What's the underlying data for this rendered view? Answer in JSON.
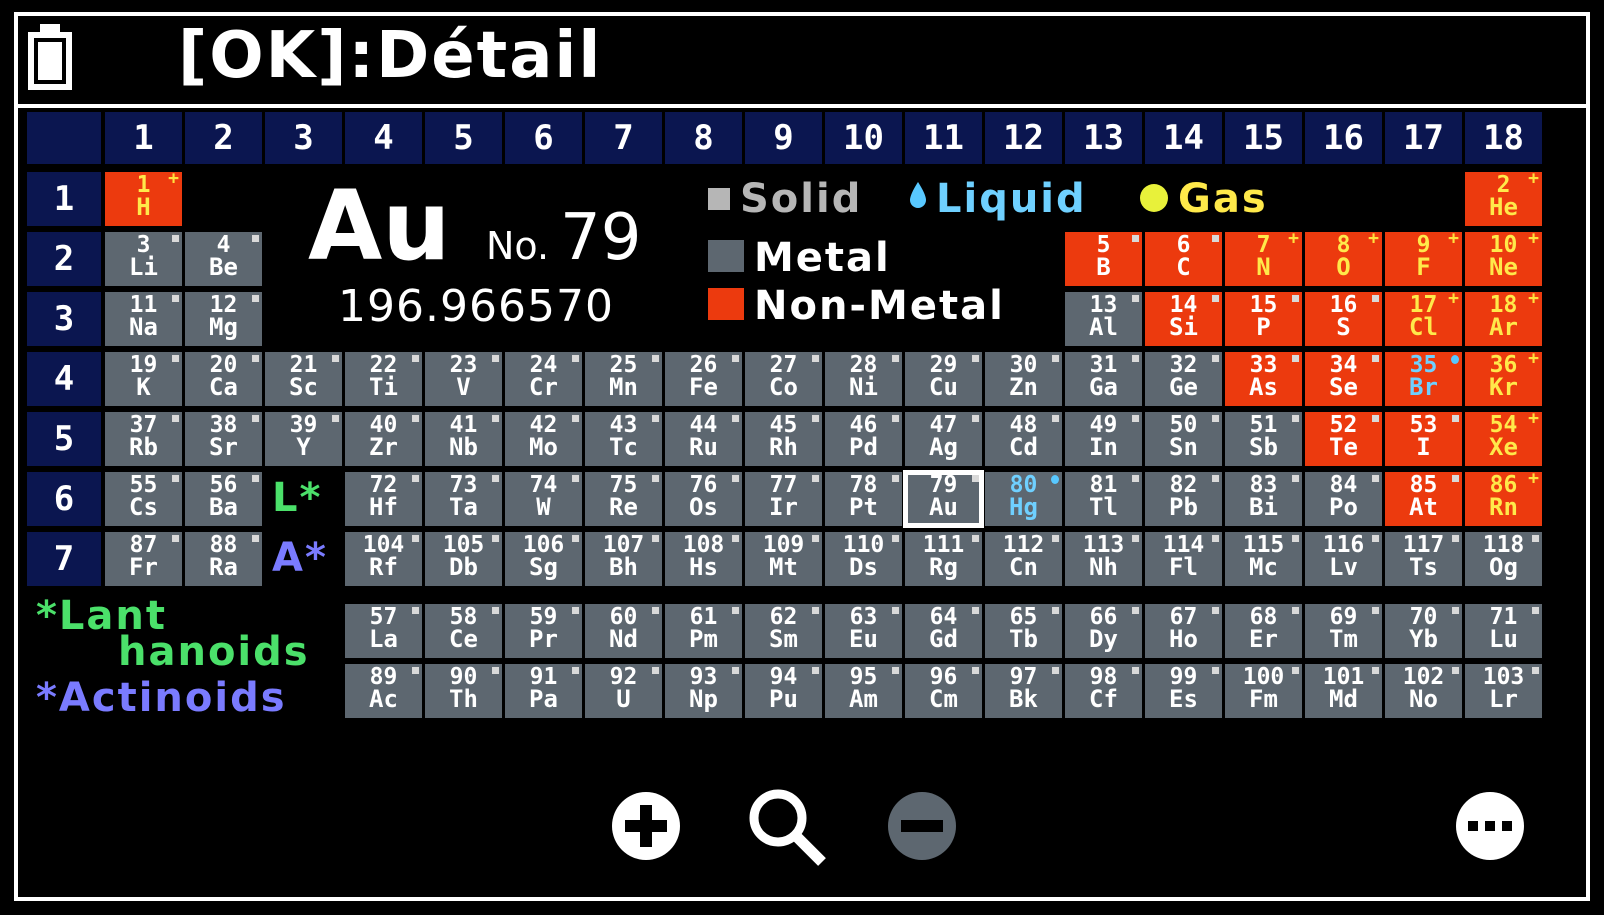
{
  "app": {
    "title": "[OK]:Détail"
  },
  "status": {
    "battery_icon": "battery-full-icon"
  },
  "groups": [
    "1",
    "2",
    "3",
    "4",
    "5",
    "6",
    "7",
    "8",
    "9",
    "10",
    "11",
    "12",
    "13",
    "14",
    "15",
    "16",
    "17",
    "18"
  ],
  "periods": [
    "1",
    "2",
    "3",
    "4",
    "5",
    "6",
    "7"
  ],
  "selected_element": {
    "symbol": "Au",
    "number_label": "No.",
    "number": "79",
    "mass": "196.966570"
  },
  "legend": {
    "solid": "Solid",
    "liquid": "Liquid",
    "gas": "Gas",
    "metal": "Metal",
    "nonmetal": "Non-Metal"
  },
  "series_markers": {
    "lanthanoid_marker": "L*",
    "actinoid_marker": "A*",
    "lanthanoids_line1": "*Lant",
    "lanthanoids_line2": "hanoids",
    "actinoids": "*Actinoids"
  },
  "colors": {
    "metal": "#5d6770",
    "nonmetal": "#ec3a0e",
    "header": "#0b1650",
    "liquid": "#6fd0ff",
    "gas": "#ffe94a",
    "lanthanoid_green": "#4be06a",
    "actinoid_blue": "#7a7bff"
  },
  "elements": [
    {
      "n": "1",
      "s": "H",
      "t": "nm",
      "st": "gas",
      "r": 1,
      "c": 1
    },
    {
      "n": "2",
      "s": "He",
      "t": "nm",
      "st": "gas",
      "r": 1,
      "c": 18
    },
    {
      "n": "3",
      "s": "Li",
      "t": "m",
      "st": "solid",
      "r": 2,
      "c": 1
    },
    {
      "n": "4",
      "s": "Be",
      "t": "m",
      "st": "solid",
      "r": 2,
      "c": 2
    },
    {
      "n": "5",
      "s": "B",
      "t": "nm",
      "st": "solid",
      "r": 2,
      "c": 13
    },
    {
      "n": "6",
      "s": "C",
      "t": "nm",
      "st": "solid",
      "r": 2,
      "c": 14
    },
    {
      "n": "7",
      "s": "N",
      "t": "nm",
      "st": "gas",
      "r": 2,
      "c": 15
    },
    {
      "n": "8",
      "s": "O",
      "t": "nm",
      "st": "gas",
      "r": 2,
      "c": 16
    },
    {
      "n": "9",
      "s": "F",
      "t": "nm",
      "st": "gas",
      "r": 2,
      "c": 17
    },
    {
      "n": "10",
      "s": "Ne",
      "t": "nm",
      "st": "gas",
      "r": 2,
      "c": 18
    },
    {
      "n": "11",
      "s": "Na",
      "t": "m",
      "st": "solid",
      "r": 3,
      "c": 1
    },
    {
      "n": "12",
      "s": "Mg",
      "t": "m",
      "st": "solid",
      "r": 3,
      "c": 2
    },
    {
      "n": "13",
      "s": "Al",
      "t": "m",
      "st": "solid",
      "r": 3,
      "c": 13
    },
    {
      "n": "14",
      "s": "Si",
      "t": "nm",
      "st": "solid",
      "r": 3,
      "c": 14
    },
    {
      "n": "15",
      "s": "P",
      "t": "nm",
      "st": "solid",
      "r": 3,
      "c": 15
    },
    {
      "n": "16",
      "s": "S",
      "t": "nm",
      "st": "solid",
      "r": 3,
      "c": 16
    },
    {
      "n": "17",
      "s": "Cl",
      "t": "nm",
      "st": "gas",
      "r": 3,
      "c": 17
    },
    {
      "n": "18",
      "s": "Ar",
      "t": "nm",
      "st": "gas",
      "r": 3,
      "c": 18
    },
    {
      "n": "19",
      "s": "K",
      "t": "m",
      "st": "solid",
      "r": 4,
      "c": 1
    },
    {
      "n": "20",
      "s": "Ca",
      "t": "m",
      "st": "solid",
      "r": 4,
      "c": 2
    },
    {
      "n": "21",
      "s": "Sc",
      "t": "m",
      "st": "solid",
      "r": 4,
      "c": 3
    },
    {
      "n": "22",
      "s": "Ti",
      "t": "m",
      "st": "solid",
      "r": 4,
      "c": 4
    },
    {
      "n": "23",
      "s": "V",
      "t": "m",
      "st": "solid",
      "r": 4,
      "c": 5
    },
    {
      "n": "24",
      "s": "Cr",
      "t": "m",
      "st": "solid",
      "r": 4,
      "c": 6
    },
    {
      "n": "25",
      "s": "Mn",
      "t": "m",
      "st": "solid",
      "r": 4,
      "c": 7
    },
    {
      "n": "26",
      "s": "Fe",
      "t": "m",
      "st": "solid",
      "r": 4,
      "c": 8
    },
    {
      "n": "27",
      "s": "Co",
      "t": "m",
      "st": "solid",
      "r": 4,
      "c": 9
    },
    {
      "n": "28",
      "s": "Ni",
      "t": "m",
      "st": "solid",
      "r": 4,
      "c": 10
    },
    {
      "n": "29",
      "s": "Cu",
      "t": "m",
      "st": "solid",
      "r": 4,
      "c": 11
    },
    {
      "n": "30",
      "s": "Zn",
      "t": "m",
      "st": "solid",
      "r": 4,
      "c": 12
    },
    {
      "n": "31",
      "s": "Ga",
      "t": "m",
      "st": "solid",
      "r": 4,
      "c": 13
    },
    {
      "n": "32",
      "s": "Ge",
      "t": "m",
      "st": "solid",
      "r": 4,
      "c": 14
    },
    {
      "n": "33",
      "s": "As",
      "t": "nm",
      "st": "solid",
      "r": 4,
      "c": 15
    },
    {
      "n": "34",
      "s": "Se",
      "t": "nm",
      "st": "solid",
      "r": 4,
      "c": 16
    },
    {
      "n": "35",
      "s": "Br",
      "t": "nm",
      "st": "liquid",
      "r": 4,
      "c": 17
    },
    {
      "n": "36",
      "s": "Kr",
      "t": "nm",
      "st": "gas",
      "r": 4,
      "c": 18
    },
    {
      "n": "37",
      "s": "Rb",
      "t": "m",
      "st": "solid",
      "r": 5,
      "c": 1
    },
    {
      "n": "38",
      "s": "Sr",
      "t": "m",
      "st": "solid",
      "r": 5,
      "c": 2
    },
    {
      "n": "39",
      "s": "Y",
      "t": "m",
      "st": "solid",
      "r": 5,
      "c": 3
    },
    {
      "n": "40",
      "s": "Zr",
      "t": "m",
      "st": "solid",
      "r": 5,
      "c": 4
    },
    {
      "n": "41",
      "s": "Nb",
      "t": "m",
      "st": "solid",
      "r": 5,
      "c": 5
    },
    {
      "n": "42",
      "s": "Mo",
      "t": "m",
      "st": "solid",
      "r": 5,
      "c": 6
    },
    {
      "n": "43",
      "s": "Tc",
      "t": "m",
      "st": "solid",
      "r": 5,
      "c": 7
    },
    {
      "n": "44",
      "s": "Ru",
      "t": "m",
      "st": "solid",
      "r": 5,
      "c": 8
    },
    {
      "n": "45",
      "s": "Rh",
      "t": "m",
      "st": "solid",
      "r": 5,
      "c": 9
    },
    {
      "n": "46",
      "s": "Pd",
      "t": "m",
      "st": "solid",
      "r": 5,
      "c": 10
    },
    {
      "n": "47",
      "s": "Ag",
      "t": "m",
      "st": "solid",
      "r": 5,
      "c": 11
    },
    {
      "n": "48",
      "s": "Cd",
      "t": "m",
      "st": "solid",
      "r": 5,
      "c": 12
    },
    {
      "n": "49",
      "s": "In",
      "t": "m",
      "st": "solid",
      "r": 5,
      "c": 13
    },
    {
      "n": "50",
      "s": "Sn",
      "t": "m",
      "st": "solid",
      "r": 5,
      "c": 14
    },
    {
      "n": "51",
      "s": "Sb",
      "t": "m",
      "st": "solid",
      "r": 5,
      "c": 15
    },
    {
      "n": "52",
      "s": "Te",
      "t": "nm",
      "st": "solid",
      "r": 5,
      "c": 16
    },
    {
      "n": "53",
      "s": "I",
      "t": "nm",
      "st": "solid",
      "r": 5,
      "c": 17
    },
    {
      "n": "54",
      "s": "Xe",
      "t": "nm",
      "st": "gas",
      "r": 5,
      "c": 18
    },
    {
      "n": "55",
      "s": "Cs",
      "t": "m",
      "st": "solid",
      "r": 6,
      "c": 1
    },
    {
      "n": "56",
      "s": "Ba",
      "t": "m",
      "st": "solid",
      "r": 6,
      "c": 2
    },
    {
      "n": "72",
      "s": "Hf",
      "t": "m",
      "st": "solid",
      "r": 6,
      "c": 4
    },
    {
      "n": "73",
      "s": "Ta",
      "t": "m",
      "st": "solid",
      "r": 6,
      "c": 5
    },
    {
      "n": "74",
      "s": "W",
      "t": "m",
      "st": "solid",
      "r": 6,
      "c": 6
    },
    {
      "n": "75",
      "s": "Re",
      "t": "m",
      "st": "solid",
      "r": 6,
      "c": 7
    },
    {
      "n": "76",
      "s": "Os",
      "t": "m",
      "st": "solid",
      "r": 6,
      "c": 8
    },
    {
      "n": "77",
      "s": "Ir",
      "t": "m",
      "st": "solid",
      "r": 6,
      "c": 9
    },
    {
      "n": "78",
      "s": "Pt",
      "t": "m",
      "st": "solid",
      "r": 6,
      "c": 10
    },
    {
      "n": "79",
      "s": "Au",
      "t": "m",
      "st": "solid",
      "r": 6,
      "c": 11,
      "sel": true
    },
    {
      "n": "80",
      "s": "Hg",
      "t": "m",
      "st": "liquid",
      "r": 6,
      "c": 12
    },
    {
      "n": "81",
      "s": "Tl",
      "t": "m",
      "st": "solid",
      "r": 6,
      "c": 13
    },
    {
      "n": "82",
      "s": "Pb",
      "t": "m",
      "st": "solid",
      "r": 6,
      "c": 14
    },
    {
      "n": "83",
      "s": "Bi",
      "t": "m",
      "st": "solid",
      "r": 6,
      "c": 15
    },
    {
      "n": "84",
      "s": "Po",
      "t": "m",
      "st": "solid",
      "r": 6,
      "c": 16
    },
    {
      "n": "85",
      "s": "At",
      "t": "nm",
      "st": "solid",
      "r": 6,
      "c": 17
    },
    {
      "n": "86",
      "s": "Rn",
      "t": "nm",
      "st": "gas",
      "r": 6,
      "c": 18
    },
    {
      "n": "87",
      "s": "Fr",
      "t": "m",
      "st": "solid",
      "r": 7,
      "c": 1
    },
    {
      "n": "88",
      "s": "Ra",
      "t": "m",
      "st": "solid",
      "r": 7,
      "c": 2
    },
    {
      "n": "104",
      "s": "Rf",
      "t": "m",
      "st": "solid",
      "r": 7,
      "c": 4
    },
    {
      "n": "105",
      "s": "Db",
      "t": "m",
      "st": "solid",
      "r": 7,
      "c": 5
    },
    {
      "n": "106",
      "s": "Sg",
      "t": "m",
      "st": "solid",
      "r": 7,
      "c": 6
    },
    {
      "n": "107",
      "s": "Bh",
      "t": "m",
      "st": "solid",
      "r": 7,
      "c": 7
    },
    {
      "n": "108",
      "s": "Hs",
      "t": "m",
      "st": "solid",
      "r": 7,
      "c": 8
    },
    {
      "n": "109",
      "s": "Mt",
      "t": "m",
      "st": "solid",
      "r": 7,
      "c": 9
    },
    {
      "n": "110",
      "s": "Ds",
      "t": "m",
      "st": "solid",
      "r": 7,
      "c": 10
    },
    {
      "n": "111",
      "s": "Rg",
      "t": "m",
      "st": "solid",
      "r": 7,
      "c": 11
    },
    {
      "n": "112",
      "s": "Cn",
      "t": "m",
      "st": "solid",
      "r": 7,
      "c": 12
    },
    {
      "n": "113",
      "s": "Nh",
      "t": "m",
      "st": "solid",
      "r": 7,
      "c": 13
    },
    {
      "n": "114",
      "s": "Fl",
      "t": "m",
      "st": "solid",
      "r": 7,
      "c": 14
    },
    {
      "n": "115",
      "s": "Mc",
      "t": "m",
      "st": "solid",
      "r": 7,
      "c": 15
    },
    {
      "n": "116",
      "s": "Lv",
      "t": "m",
      "st": "solid",
      "r": 7,
      "c": 16
    },
    {
      "n": "117",
      "s": "Ts",
      "t": "m",
      "st": "solid",
      "r": 7,
      "c": 17
    },
    {
      "n": "118",
      "s": "Og",
      "t": "m",
      "st": "solid",
      "r": 7,
      "c": 18
    },
    {
      "n": "57",
      "s": "La",
      "t": "m",
      "st": "solid",
      "r": 8,
      "c": 4
    },
    {
      "n": "58",
      "s": "Ce",
      "t": "m",
      "st": "solid",
      "r": 8,
      "c": 5
    },
    {
      "n": "59",
      "s": "Pr",
      "t": "m",
      "st": "solid",
      "r": 8,
      "c": 6
    },
    {
      "n": "60",
      "s": "Nd",
      "t": "m",
      "st": "solid",
      "r": 8,
      "c": 7
    },
    {
      "n": "61",
      "s": "Pm",
      "t": "m",
      "st": "solid",
      "r": 8,
      "c": 8
    },
    {
      "n": "62",
      "s": "Sm",
      "t": "m",
      "st": "solid",
      "r": 8,
      "c": 9
    },
    {
      "n": "63",
      "s": "Eu",
      "t": "m",
      "st": "solid",
      "r": 8,
      "c": 10
    },
    {
      "n": "64",
      "s": "Gd",
      "t": "m",
      "st": "solid",
      "r": 8,
      "c": 11
    },
    {
      "n": "65",
      "s": "Tb",
      "t": "m",
      "st": "solid",
      "r": 8,
      "c": 12
    },
    {
      "n": "66",
      "s": "Dy",
      "t": "m",
      "st": "solid",
      "r": 8,
      "c": 13
    },
    {
      "n": "67",
      "s": "Ho",
      "t": "m",
      "st": "solid",
      "r": 8,
      "c": 14
    },
    {
      "n": "68",
      "s": "Er",
      "t": "m",
      "st": "solid",
      "r": 8,
      "c": 15
    },
    {
      "n": "69",
      "s": "Tm",
      "t": "m",
      "st": "solid",
      "r": 8,
      "c": 16
    },
    {
      "n": "70",
      "s": "Yb",
      "t": "m",
      "st": "solid",
      "r": 8,
      "c": 17
    },
    {
      "n": "71",
      "s": "Lu",
      "t": "m",
      "st": "solid",
      "r": 8,
      "c": 18
    },
    {
      "n": "89",
      "s": "Ac",
      "t": "m",
      "st": "solid",
      "r": 9,
      "c": 4
    },
    {
      "n": "90",
      "s": "Th",
      "t": "m",
      "st": "solid",
      "r": 9,
      "c": 5
    },
    {
      "n": "91",
      "s": "Pa",
      "t": "m",
      "st": "solid",
      "r": 9,
      "c": 6
    },
    {
      "n": "92",
      "s": "U",
      "t": "m",
      "st": "solid",
      "r": 9,
      "c": 7
    },
    {
      "n": "93",
      "s": "Np",
      "t": "m",
      "st": "solid",
      "r": 9,
      "c": 8
    },
    {
      "n": "94",
      "s": "Pu",
      "t": "m",
      "st": "solid",
      "r": 9,
      "c": 9
    },
    {
      "n": "95",
      "s": "Am",
      "t": "m",
      "st": "solid",
      "r": 9,
      "c": 10
    },
    {
      "n": "96",
      "s": "Cm",
      "t": "m",
      "st": "solid",
      "r": 9,
      "c": 11
    },
    {
      "n": "97",
      "s": "Bk",
      "t": "m",
      "st": "solid",
      "r": 9,
      "c": 12
    },
    {
      "n": "98",
      "s": "Cf",
      "t": "m",
      "st": "solid",
      "r": 9,
      "c": 13
    },
    {
      "n": "99",
      "s": "Es",
      "t": "m",
      "st": "solid",
      "r": 9,
      "c": 14
    },
    {
      "n": "100",
      "s": "Fm",
      "t": "m",
      "st": "solid",
      "r": 9,
      "c": 15
    },
    {
      "n": "101",
      "s": "Md",
      "t": "m",
      "st": "solid",
      "r": 9,
      "c": 16
    },
    {
      "n": "102",
      "s": "No",
      "t": "m",
      "st": "solid",
      "r": 9,
      "c": 17
    },
    {
      "n": "103",
      "s": "Lr",
      "t": "m",
      "st": "solid",
      "r": 9,
      "c": 18
    }
  ],
  "toolbar": {
    "zoom_in_icon": "plus-circle-icon",
    "search_icon": "magnifier-icon",
    "zoom_out_icon": "minus-circle-icon",
    "more_icon": "more-options-icon"
  }
}
